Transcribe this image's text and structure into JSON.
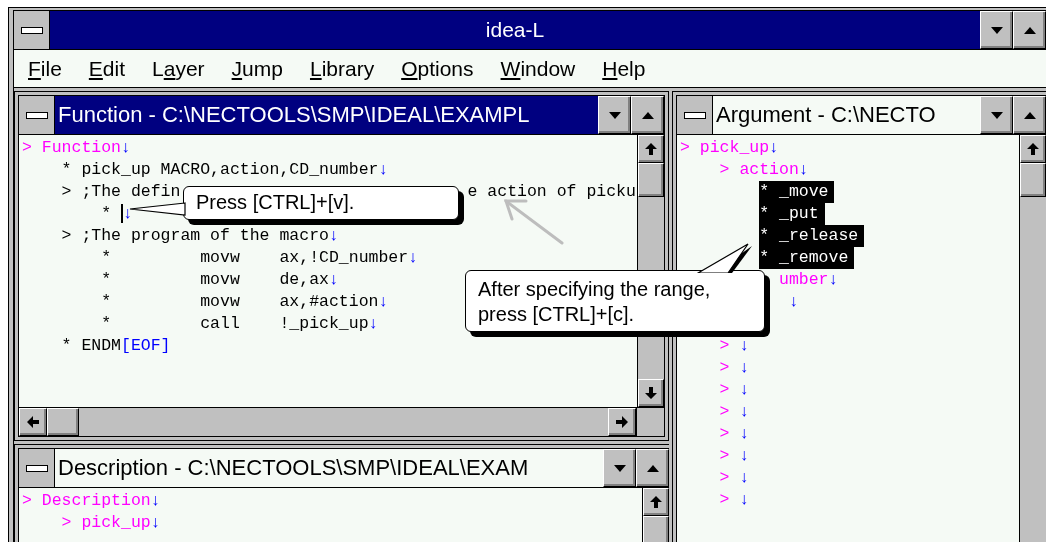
{
  "window": {
    "title": "idea-L"
  },
  "menu": [
    {
      "key": "F",
      "after": "ile"
    },
    {
      "key": "E",
      "after": "dit"
    },
    {
      "before": "L",
      "key": "a",
      "after": "yer"
    },
    {
      "key": "J",
      "after": "ump"
    },
    {
      "key": "L",
      "after": "ibrary"
    },
    {
      "key": "O",
      "after": "ptions"
    },
    {
      "key": "W",
      "after": "indow"
    },
    {
      "key": "H",
      "after": "elp"
    }
  ],
  "documents": [
    {
      "title": "Function - C:\\NECTOOLS\\SMP\\IDEAL\\EXAMPL",
      "active": true,
      "lines": [
        {
          "kind": "heading",
          "marker": ">",
          "text": "Function",
          "eol": "↓",
          "children": [
            {
              "kind": "statement",
              "marker": "*",
              "text": "pick_up MACRO,action,CD_number",
              "eol": "↓"
            },
            {
              "kind": "comment",
              "marker": ">",
              "text": ";The defin",
              "tail": "e action of picku",
              "children": [
                {
                  "kind": "statement",
                  "marker": "*",
                  "cursor": true,
                  "eol": "↓"
                }
              ]
            },
            {
              "kind": "comment",
              "marker": ">",
              "text": ";The program of the macro",
              "eol": "↓",
              "children": [
                {
                  "kind": "instruction",
                  "marker": "*",
                  "op": "movw",
                  "operands": "ax,!CD_number",
                  "eol": "↓"
                },
                {
                  "kind": "instruction",
                  "marker": "*",
                  "op": "movw",
                  "operands": "de,ax",
                  "eol": "↓"
                },
                {
                  "kind": "instruction",
                  "marker": "*",
                  "op": "movw",
                  "operands": "ax,#action",
                  "eol": "↓"
                },
                {
                  "kind": "instruction",
                  "marker": "*",
                  "op": "call",
                  "operands": "!_pick_up",
                  "eol": "↓"
                }
              ]
            },
            {
              "kind": "statement",
              "marker": "*",
              "text": "ENDM",
              "eol": "[EOF]"
            }
          ]
        }
      ]
    },
    {
      "title": "Argument - C:\\NECTO",
      "active": false,
      "lines": [
        {
          "kind": "heading",
          "marker": ">",
          "text": "pick_up",
          "eol": "↓",
          "children": [
            {
              "kind": "heading",
              "marker": ">",
              "text": "action",
              "eol": "↓",
              "children": [
                {
                  "kind": "statement",
                  "marker": "*",
                  "text": "_move",
                  "selected": true
                },
                {
                  "kind": "statement",
                  "marker": "*",
                  "text": "_put",
                  "selected": true
                },
                {
                  "kind": "statement",
                  "marker": "*",
                  "text": "_release",
                  "selected": true
                },
                {
                  "kind": "statement",
                  "marker": "*",
                  "text": "_remove",
                  "selected": true
                }
              ]
            },
            {
              "kind": "partial",
              "text": "umber",
              "eol": "↓",
              "children": [
                {
                  "kind": "continuation",
                  "eol": "↓"
                }
              ]
            },
            {
              "kind": "heading",
              "marker": ">",
              "eol": "↓"
            },
            {
              "kind": "heading",
              "marker": ">",
              "eol": "↓"
            },
            {
              "kind": "heading",
              "marker": ">",
              "eol": "↓"
            },
            {
              "kind": "heading",
              "marker": ">",
              "eol": "↓"
            },
            {
              "kind": "heading",
              "marker": ">",
              "eol": "↓"
            },
            {
              "kind": "heading",
              "marker": ">",
              "eol": "↓"
            },
            {
              "kind": "heading",
              "marker": ">",
              "eol": "↓"
            },
            {
              "kind": "heading",
              "marker": ">",
              "eol": "↓"
            }
          ]
        }
      ]
    },
    {
      "title": "Description - C:\\NECTOOLS\\SMP\\IDEAL\\EXAM",
      "active": false,
      "lines": [
        {
          "kind": "heading",
          "marker": ">",
          "text": "Description",
          "eol": "↓",
          "children": [
            {
              "kind": "heading",
              "marker": ">",
              "text": "pick_up",
              "eol": "↓"
            }
          ]
        }
      ]
    }
  ],
  "callouts": [
    {
      "text": "Press [CTRL]+[v]."
    },
    {
      "text": "After specifying the range, press [CTRL]+[c]."
    }
  ]
}
